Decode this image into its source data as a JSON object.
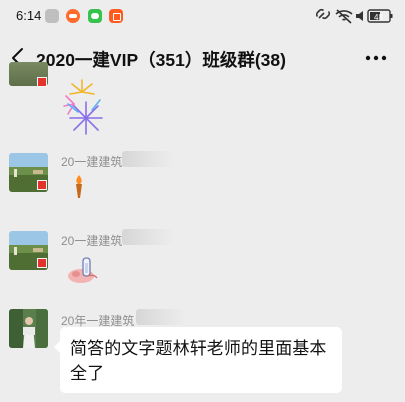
{
  "status_bar": {
    "time": "6:14",
    "battery": "48"
  },
  "nav": {
    "title": "2020一建VIP（351）班级群(38)"
  },
  "messages": [
    {
      "sender": "",
      "content_type": "sticker",
      "sticker": "fireworks"
    },
    {
      "sender": "20一建建筑",
      "content_type": "sticker",
      "sticker": "torch-emoji"
    },
    {
      "sender": "20一建建筑",
      "content_type": "sticker",
      "sticker": "hand-holding-tube"
    },
    {
      "sender": "20年一建建筑",
      "content_type": "text",
      "text": "简答的文字题林轩老师的里面基本全了"
    }
  ],
  "colors": {
    "background": "#ededed",
    "bubble": "#ffffff",
    "sender_name": "#8f8f8f",
    "flag": "#e3332e"
  }
}
